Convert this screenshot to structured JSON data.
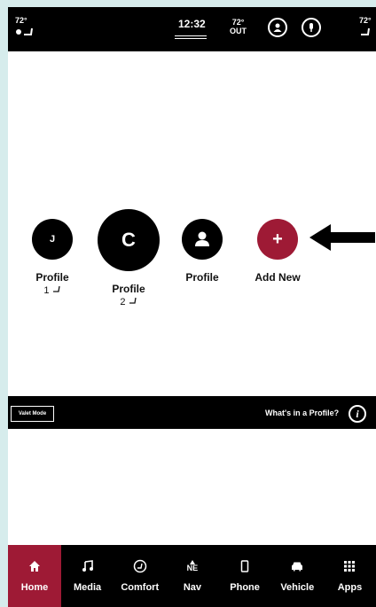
{
  "status": {
    "left_temp": "72°",
    "clock": "12:32",
    "outside_temp": "72°",
    "outside_label": "OUT",
    "right_temp": "72°"
  },
  "profiles": [
    {
      "initial": "J",
      "label": "Profile",
      "sub": "1"
    },
    {
      "initial": "C",
      "label": "Profile",
      "sub": "2"
    },
    {
      "initial": "",
      "label": "Profile",
      "sub": ""
    },
    {
      "initial": "+",
      "label": "Add New",
      "sub": ""
    }
  ],
  "midbar": {
    "valet_label": "Valet Mode",
    "whats_label": "What's in a Profile?",
    "info_glyph": "i"
  },
  "nav": [
    {
      "label": "Home",
      "icon": "home-icon"
    },
    {
      "label": "Media",
      "icon": "music-note-icon"
    },
    {
      "label": "Comfort",
      "icon": "comfort-icon"
    },
    {
      "label": "Nav",
      "icon": "compass-icon",
      "glyph": "NE"
    },
    {
      "label": "Phone",
      "icon": "phone-icon"
    },
    {
      "label": "Vehicle",
      "icon": "car-icon"
    },
    {
      "label": "Apps",
      "icon": "apps-grid-icon"
    }
  ],
  "colors": {
    "accent": "#9e1a35",
    "background": "#000000",
    "panel": "#ffffff"
  }
}
